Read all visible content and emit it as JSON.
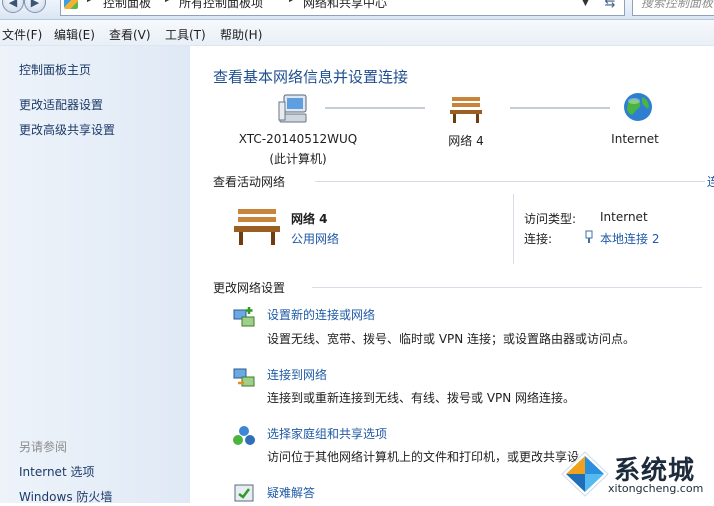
{
  "window": {
    "breadcrumb": [
      "控制面板",
      "所有控制面板项",
      "网络和共享中心"
    ],
    "search_placeholder": "搜索控制面板"
  },
  "menu": [
    "文件(F)",
    "编辑(E)",
    "查看(V)",
    "工具(T)",
    "帮助(H)"
  ],
  "sidebar": {
    "home": "控制面板主页",
    "links": [
      "更改适配器设置",
      "更改高级共享设置"
    ],
    "see_also_heading": "另请参阅",
    "see_also": [
      "Internet 选项",
      "Windows 防火墙"
    ]
  },
  "main": {
    "title": "查看基本网络信息并设置连接",
    "map": {
      "computer_name": "XTC-20140512WUQ",
      "computer_sub": "(此计算机)",
      "network_name": "网络  4",
      "internet": "Internet"
    },
    "active_section": "查看活动网络",
    "active_more": "连",
    "active": {
      "name": "网络  4",
      "type": "公用网络",
      "access_label": "访问类型:",
      "access_value": "Internet",
      "conn_label": "连接:",
      "conn_value": "本地连接 2"
    },
    "change_section": "更改网络设置",
    "tasks": [
      {
        "icon": "new-connection-icon",
        "title": "设置新的连接或网络",
        "desc": "设置无线、宽带、拨号、临时或 VPN 连接；或设置路由器或访问点。"
      },
      {
        "icon": "connect-network-icon",
        "title": "连接到网络",
        "desc": "连接到或重新连接到无线、有线、拨号或 VPN 网络连接。"
      },
      {
        "icon": "homegroup-icon",
        "title": "选择家庭组和共享选项",
        "desc": "访问位于其他网络计算机上的文件和打印机，或更改共享设"
      },
      {
        "icon": "troubleshoot-icon",
        "title": "疑难解答",
        "desc": ""
      }
    ]
  },
  "watermark": {
    "text": "系统城",
    "url": "xitongcheng.com"
  }
}
